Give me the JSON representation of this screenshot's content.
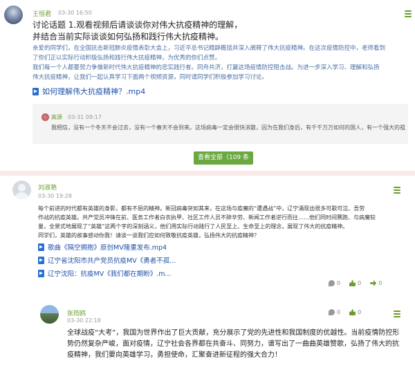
{
  "post": {
    "author": "王恒君",
    "timestamp": "03-30 16:50",
    "title_lines": [
      "讨论话题 1.观看视频后请谈谈你对伟大抗疫精神的理解，",
      "并结合当前实际谈谈如何弘扬和践行伟大抗疫精神。"
    ],
    "body_lines": [
      "亲爱的同学们，在全国抗击新冠肺炎疫情表彰大会上，习近平总书记精辟概括并深入阐释了伟大抗疫精神。在这次疫情防控中，老师看到",
      "了你们正以实际行动积极弘扬和践行伟大抗疫精神，为优秀的你们点赞。",
      "    我们每一个人都要努力争做新时代伟大抗疫精神的忠实践行者。同舟共济，打赢这场疫情防控阻击战。为进一步深入学习、理解和弘扬",
      "伟大抗疫精神，让我们一起认真学习下面两个视频资源，同时请同学们积极参加学习讨论。"
    ],
    "attachment": "如何理解伟大抗疫精神？.mp4",
    "reply": {
      "author": "高源",
      "timestamp": "03-31 09:17",
      "text": "我相信，没有一个冬天不会过去，没有一个春天不会到来。这场病毒一定会很快消散，因为在我们身后，有千千万万如何的国人，有一个强大的祖国!"
    },
    "view_all_label": "查看全部（109 条"
  },
  "comment": {
    "author": "刘淑艳",
    "timestamp": "03-30 19:28",
    "body_lines": [
      "每个前进的时代都有英雄的身影，都有不屈的精神。新冠病毒突如其来，在这场与疫魔的“遭遇战”中，辽宁涌现出很多可歌可泣、吾劳",
      "作战的抗疫英雄。共产党员冲锋在前、医务工作者白衣执甲、社区工作人员不辞辛劳、新闻工作者逆行而往……他们同时间赛跑、与病魔较",
      "量，全景式地展现了“英雄”这两个字的深刻涵义，他们用实际行动践行了人民至上、生命至上的理念，展现了伟大的抗疫精神。",
      "同学们，英雄的故事感动你我！请谈一谈我们应如何致敬抗疫英雄，弘扬伟大的抗疫精神？"
    ],
    "attachments": [
      "歌曲《隔空拥抱》原创MV隆重发布.mp4",
      "辽宁省沈阳市共产党员抗疫MV《勇者不孤...",
      "辽宁沈阳：抗疫MV《我们都在期盼》.m..."
    ],
    "stats": {
      "replies": "0",
      "likes": "0",
      "forward": "0"
    }
  },
  "sub_comment": {
    "author": "张筠鸥",
    "timestamp": "03-30 22:18",
    "stats": {
      "replies": "0",
      "likes": "0"
    },
    "text": "全球战疫“大考”，我国为世界作出了巨大贡献，充分展示了党的先进性和我国制度的优越性。当前疫情防控形势仍然复杂严峻，面对疫情，辽宁社会各界都在共奋斗、同努力，谱写出了一曲曲英雄赞歌，弘扬了伟大的抗疫精神，我们要向英雄学习，勇担使命，汇聚奋进新征程的强大合力！"
  }
}
